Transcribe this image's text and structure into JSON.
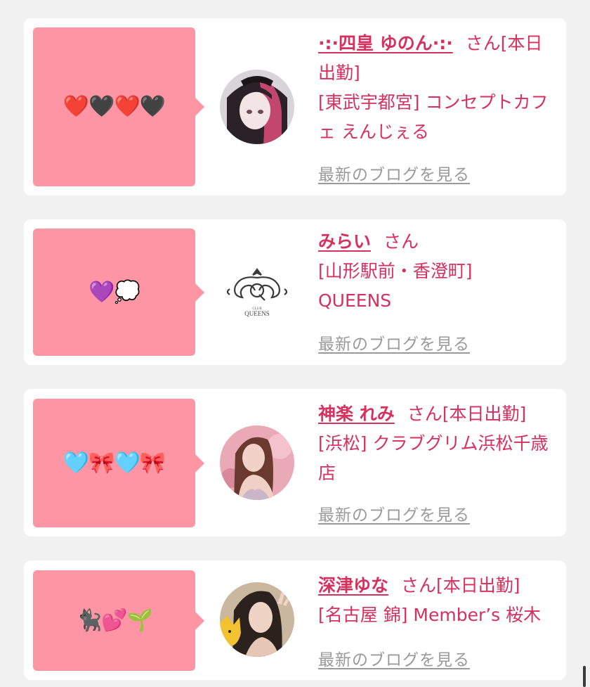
{
  "entries": [
    {
      "emoji": "❤️🖤❤️🖤",
      "name": "·͙⁺˚*･༓☾四皇 ゆのん☽༓･*˚⁺‧͙",
      "name_display": "·:·四皇 ゆのん·:·",
      "san": "さん",
      "status": "[本日出勤]",
      "location": "[東武宇都宮] コンセプトカフェ えんじぇる",
      "blog_link": "最新のブログを見る",
      "avatar": "girl-pink-black-hair-avatar"
    },
    {
      "emoji": "💜💭",
      "name_display": "みらい",
      "san": "さん",
      "status": "",
      "location": "[山形駅前・香澄町] QUEENS",
      "blog_link": "最新のブログを見る",
      "avatar": "queens-logo-avatar"
    },
    {
      "emoji": "🩵🎀🩵🎀",
      "name_display": "神楽 れみ",
      "san": "さん",
      "status": "[本日出勤]",
      "location": "[浜松] クラブグリム浜松千歳店",
      "blog_link": "最新のブログを見る",
      "avatar": "woman-pink-background-avatar"
    },
    {
      "emoji": "🐈‍⬛💕🌱",
      "name_display": "深津ゆな",
      "san": "さん",
      "status": "[本日出勤]",
      "location": "[名古屋 錦] Member’s 桜木",
      "blog_link": "最新のブログを見る",
      "avatar": "woman-peace-sign-avatar"
    }
  ]
}
